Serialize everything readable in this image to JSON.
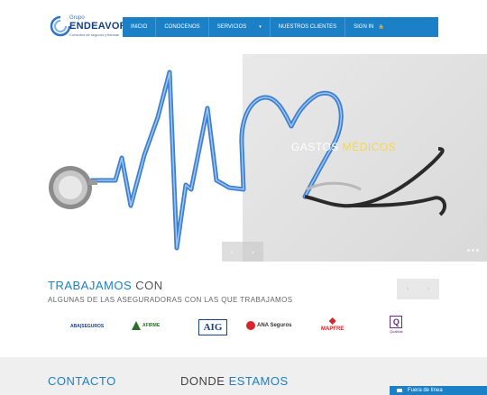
{
  "brand": {
    "top": "Grupo",
    "name": "ENDEAVOR",
    "tagline": "Consultor de seguros y fianzas"
  },
  "nav": {
    "items": [
      "Inicio",
      "Conocenos",
      "Servicios",
      "Nuestros Clientes",
      "Sign In"
    ]
  },
  "hero": {
    "title_main": "GASTOS ",
    "title_accent": "MÉDICOS",
    "prev": "‹",
    "next": "›",
    "dot_count": 3
  },
  "insurers": {
    "title_main": "TRABAJAMOS",
    "title_rest": " CON",
    "subtitle": "ALGUNAS DE LAS ASEGURADORAS CON LAS QUE TRABAJAMOS",
    "prev": "‹",
    "next": "›",
    "logos": {
      "aba": "ABA|SEGUROS",
      "afirme": "AFIRME",
      "aig": "AIG",
      "ana": "ANA Seguros",
      "mapfre": "MAPFRE",
      "qualitas": "Quálitas"
    }
  },
  "footer": {
    "contact_title": "CONTACTO",
    "where_main": "DONDE ",
    "where_accent": "ESTAMOS"
  },
  "chat": {
    "label": "Fuera de línea"
  },
  "colors": {
    "primary": "#1c80c7",
    "accent": "#f4d84a"
  }
}
